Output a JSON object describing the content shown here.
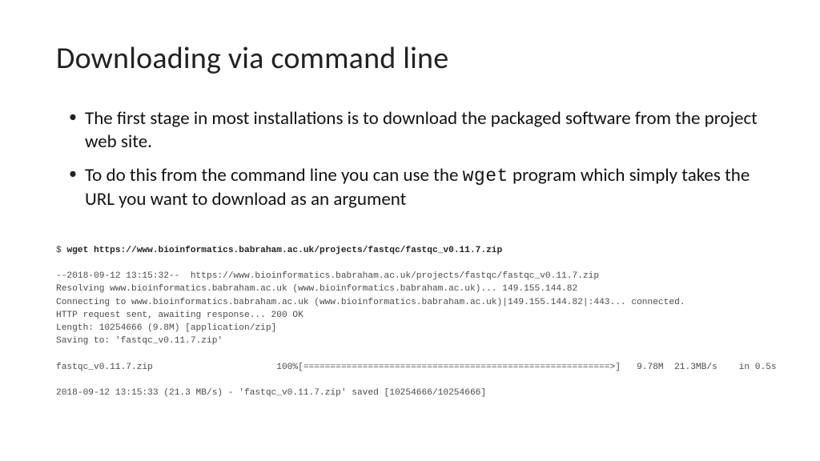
{
  "title": "Downloading via command line",
  "bullets": [
    {
      "pre": "The first stage in most installations is to download the packaged software from the project web site.",
      "code": "",
      "post": ""
    },
    {
      "pre": "To do this from the command line you can use the ",
      "code": "wget",
      "post": " program which simply takes the URL you want to download as an argument"
    }
  ],
  "terminal": {
    "prompt": "$ ",
    "command": "wget https://www.bioinformatics.babraham.ac.uk/projects/fastqc/fastqc_v0.11.7.zip",
    "output": "--2018-09-12 13:15:32--  https://www.bioinformatics.babraham.ac.uk/projects/fastqc/fastqc_v0.11.7.zip\nResolving www.bioinformatics.babraham.ac.uk (www.bioinformatics.babraham.ac.uk)... 149.155.144.82\nConnecting to www.bioinformatics.babraham.ac.uk (www.bioinformatics.babraham.ac.uk)|149.155.144.82|:443... connected.\nHTTP request sent, awaiting response... 200 OK\nLength: 10254666 (9.8M) [application/zip]\nSaving to: 'fastqc_v0.11.7.zip'\n\nfastqc_v0.11.7.zip                       100%[=========================================================>]   9.78M  21.3MB/s    in 0.5s\n\n2018-09-12 13:15:33 (21.3 MB/s) - 'fastqc_v0.11.7.zip' saved [10254666/10254666]"
  }
}
